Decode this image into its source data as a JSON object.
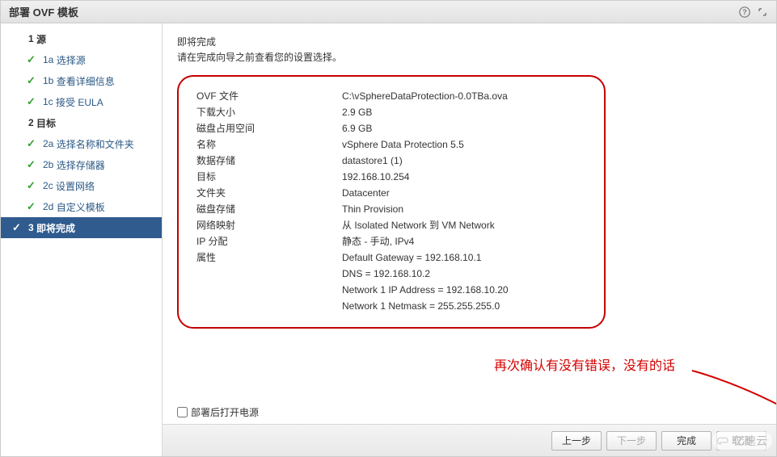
{
  "titlebar": {
    "title": "部署 OVF 模板"
  },
  "sidebar": {
    "items": [
      {
        "num": "1",
        "label": "源",
        "level": 1,
        "checked": false
      },
      {
        "num": "1a",
        "label": "选择源",
        "level": 2,
        "checked": true
      },
      {
        "num": "1b",
        "label": "查看详细信息",
        "level": 2,
        "checked": true
      },
      {
        "num": "1c",
        "label": "接受 EULA",
        "level": 2,
        "checked": true
      },
      {
        "num": "2",
        "label": "目标",
        "level": 1,
        "checked": false
      },
      {
        "num": "2a",
        "label": "选择名称和文件夹",
        "level": 2,
        "checked": true
      },
      {
        "num": "2b",
        "label": "选择存储器",
        "level": 2,
        "checked": true
      },
      {
        "num": "2c",
        "label": "设置网络",
        "level": 2,
        "checked": true
      },
      {
        "num": "2d",
        "label": "自定义模板",
        "level": 2,
        "checked": true
      },
      {
        "num": "3",
        "label": "即将完成",
        "level": 1,
        "checked": true,
        "current": true
      }
    ]
  },
  "content": {
    "heading": "即将完成",
    "subheading": "请在完成向导之前查看您的设置选择。",
    "rows": [
      {
        "k": "OVF 文件",
        "v": "C:\\vSphereDataProtection-0.0TBa.ova"
      },
      {
        "k": "下载大小",
        "v": "2.9 GB"
      },
      {
        "k": "磁盘占用空间",
        "v": "6.9 GB"
      },
      {
        "k": "名称",
        "v": "vSphere Data Protection 5.5"
      },
      {
        "k": "数据存储",
        "v": "datastore1 (1)"
      },
      {
        "k": "目标",
        "v": "192.168.10.254"
      },
      {
        "k": "文件夹",
        "v": "Datacenter"
      },
      {
        "k": "磁盘存储",
        "v": "Thin Provision"
      },
      {
        "k": "网络映射",
        "v": "从 Isolated Network 到 VM Network"
      },
      {
        "k": "IP 分配",
        "v": "静态 - 手动, IPv4"
      },
      {
        "k": "属性",
        "v_multi": [
          "Default Gateway = 192.168.10.1",
          "DNS = 192.168.10.2",
          "Network 1 IP Address = 192.168.10.20",
          "Network 1 Netmask = 255.255.255.0"
        ]
      }
    ],
    "annotation": "再次确认有没有错误，没有的话",
    "power_on_label": "部署后打开电源"
  },
  "footer": {
    "back": "上一步",
    "next": "下一步",
    "finish": "完成",
    "cancel": "取消"
  },
  "watermark": "亿速云"
}
